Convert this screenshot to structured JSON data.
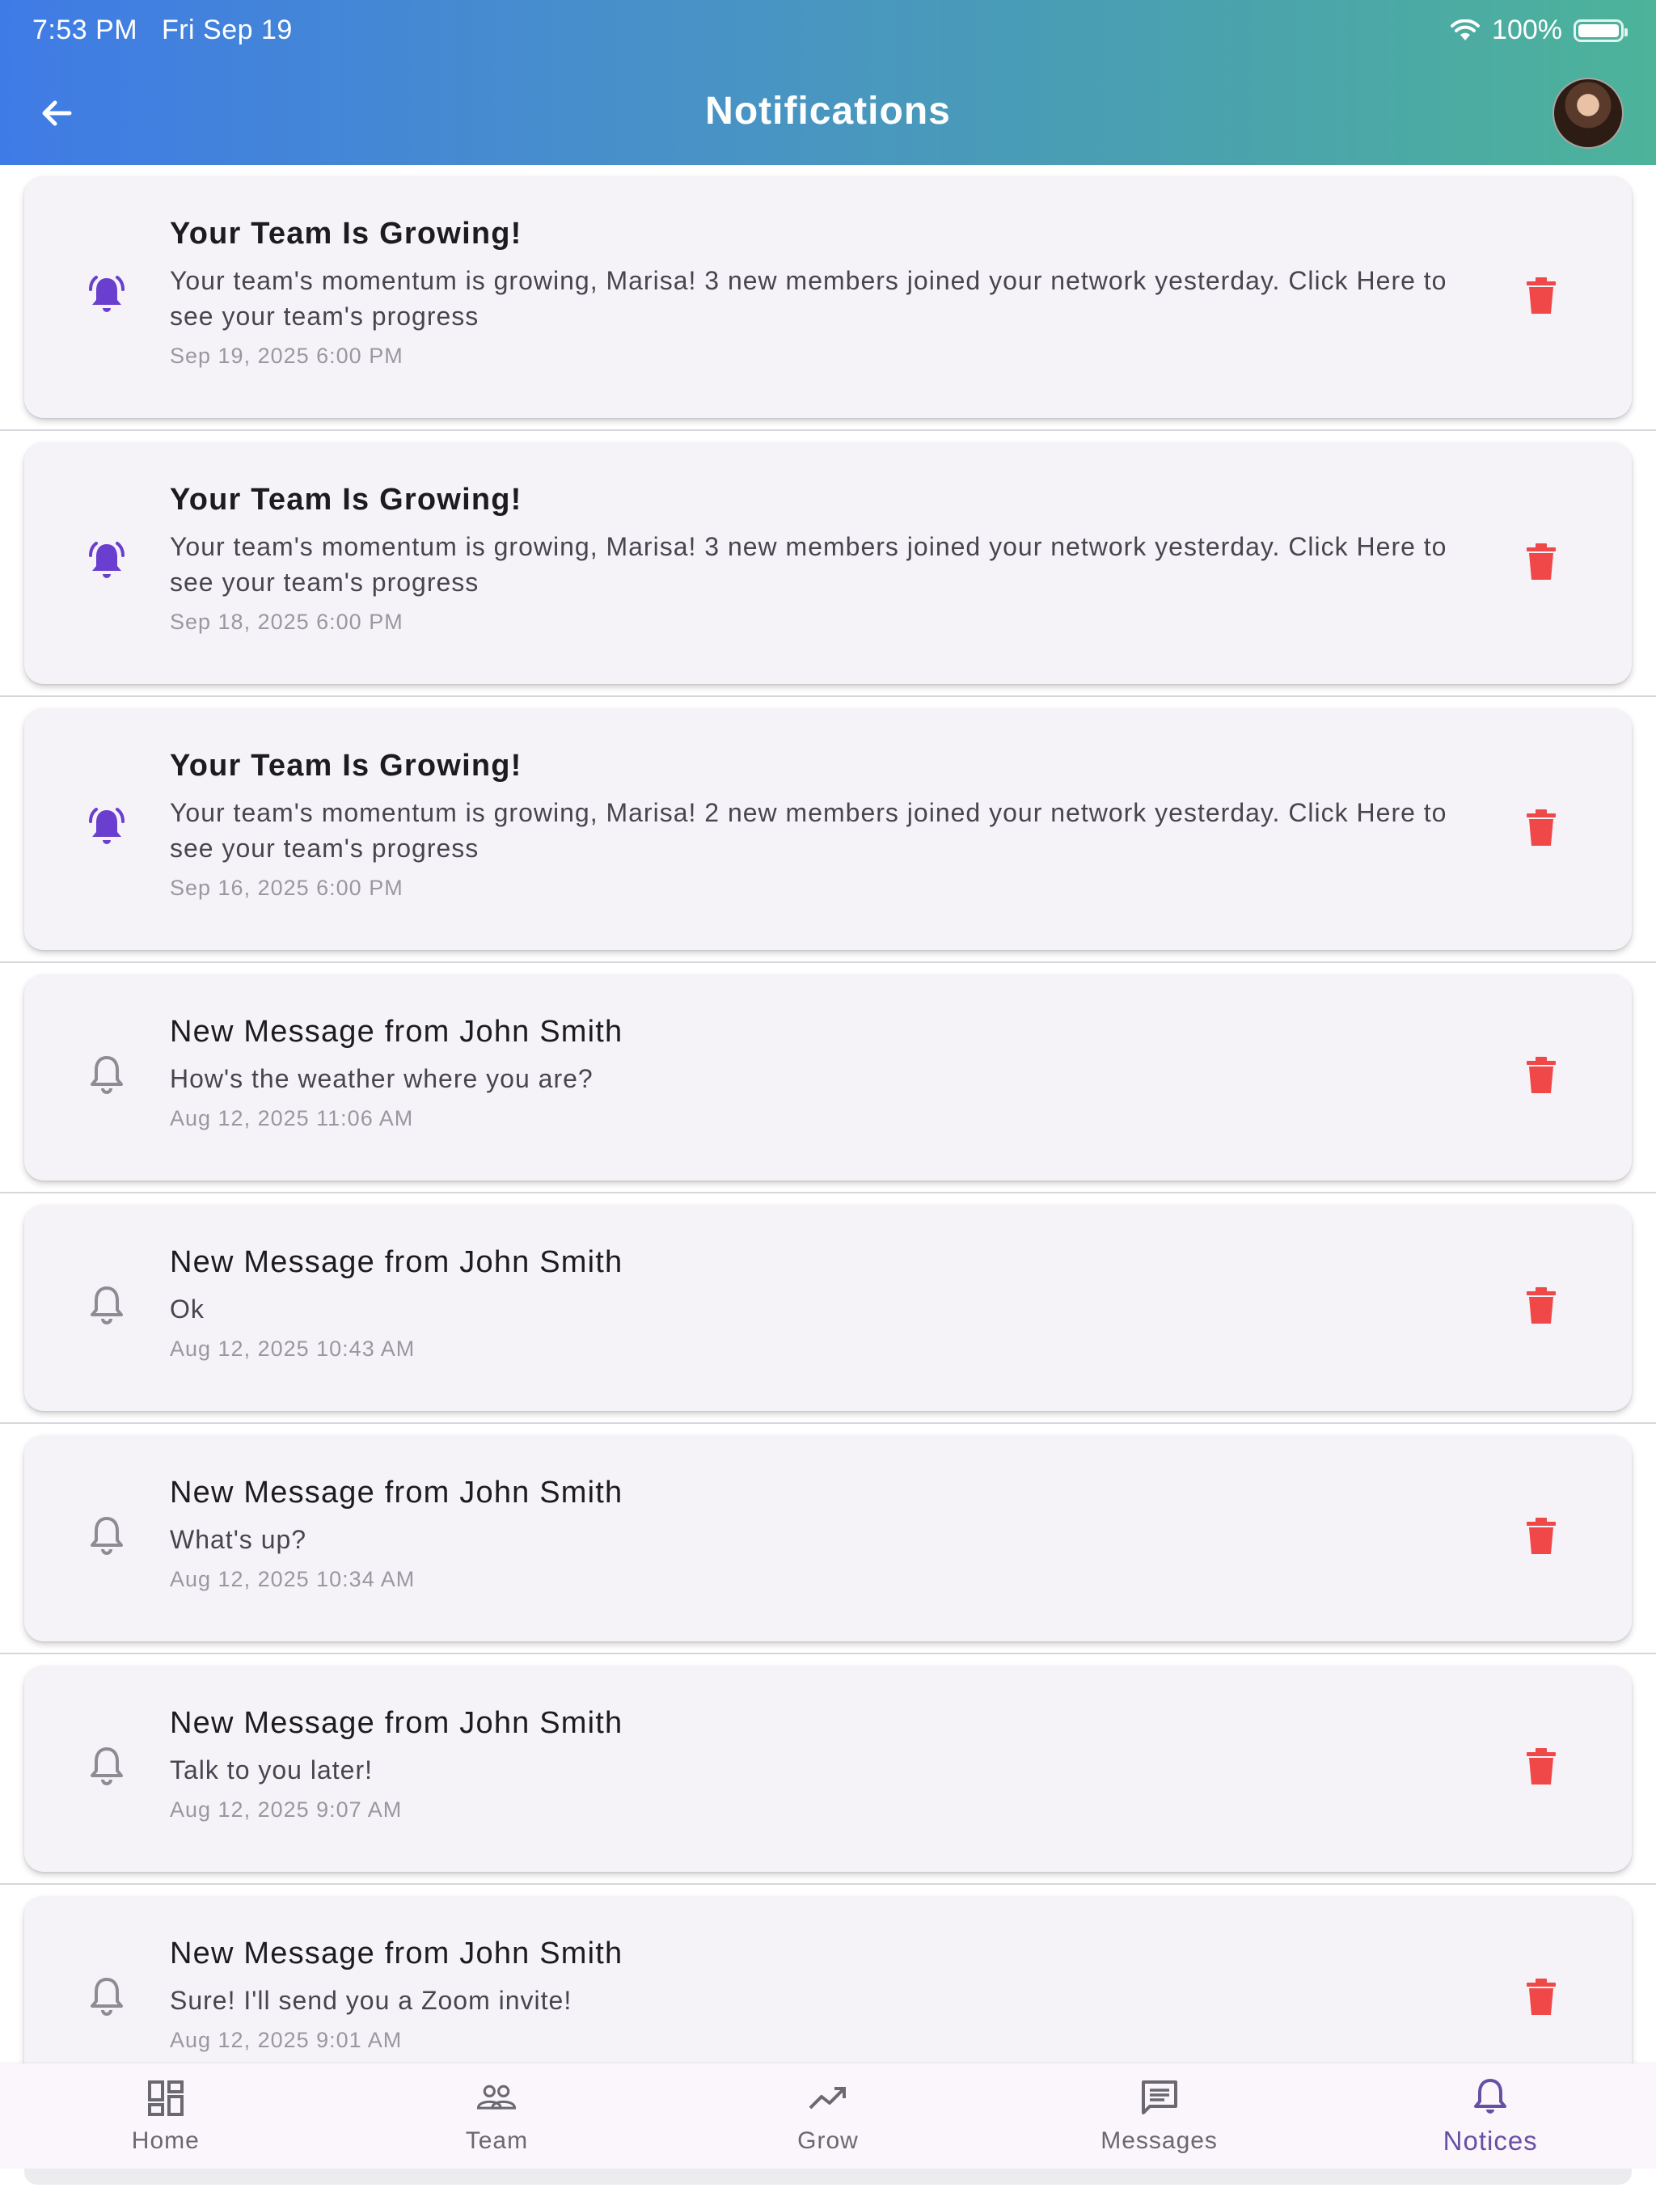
{
  "status_bar": {
    "time": "7:53 PM",
    "date": "Fri Sep 19",
    "battery": "100%"
  },
  "header": {
    "title": "Notifications",
    "back_icon": "arrow-left-icon",
    "avatar": "user-avatar"
  },
  "colors": {
    "accent": "#6750a4",
    "bell_active": "#6a3fd0",
    "bell_inactive": "#8e8c93",
    "trash": "#f04848"
  },
  "notifications": [
    {
      "title": "Your Team Is Growing!",
      "body": "Your team's momentum is growing, Marisa! 3 new members joined your network yesterday. Click Here to see your team's progress",
      "time": "Sep 19, 2025 6:00 PM",
      "unread": true
    },
    {
      "title": "Your Team Is Growing!",
      "body": "Your team's momentum is growing, Marisa! 3 new members joined your network yesterday. Click Here to see your team's progress",
      "time": "Sep 18, 2025 6:00 PM",
      "unread": true
    },
    {
      "title": "Your Team Is Growing!",
      "body": "Your team's momentum is growing, Marisa! 2 new members joined your network yesterday. Click Here to see your team's progress",
      "time": "Sep 16, 2025 6:00 PM",
      "unread": true
    },
    {
      "title": "New Message from John Smith",
      "body": "How's the weather where you are?",
      "time": "Aug 12, 2025 11:06 AM",
      "unread": false
    },
    {
      "title": "New Message from John Smith",
      "body": "Ok",
      "time": "Aug 12, 2025 10:43 AM",
      "unread": false
    },
    {
      "title": "New Message from John Smith",
      "body": "What's up?",
      "time": "Aug 12, 2025 10:34 AM",
      "unread": false
    },
    {
      "title": "New Message from John Smith",
      "body": "Talk to you later!",
      "time": "Aug 12, 2025 9:07 AM",
      "unread": false
    },
    {
      "title": "New Message from John Smith",
      "body": "Sure! I'll send you a Zoom invite!",
      "time": "Aug 12, 2025 9:01 AM",
      "unread": false
    }
  ],
  "nav": {
    "home": "Home",
    "team": "Team",
    "grow": "Grow",
    "messages": "Messages",
    "notices": "Notices",
    "active": "notices"
  }
}
